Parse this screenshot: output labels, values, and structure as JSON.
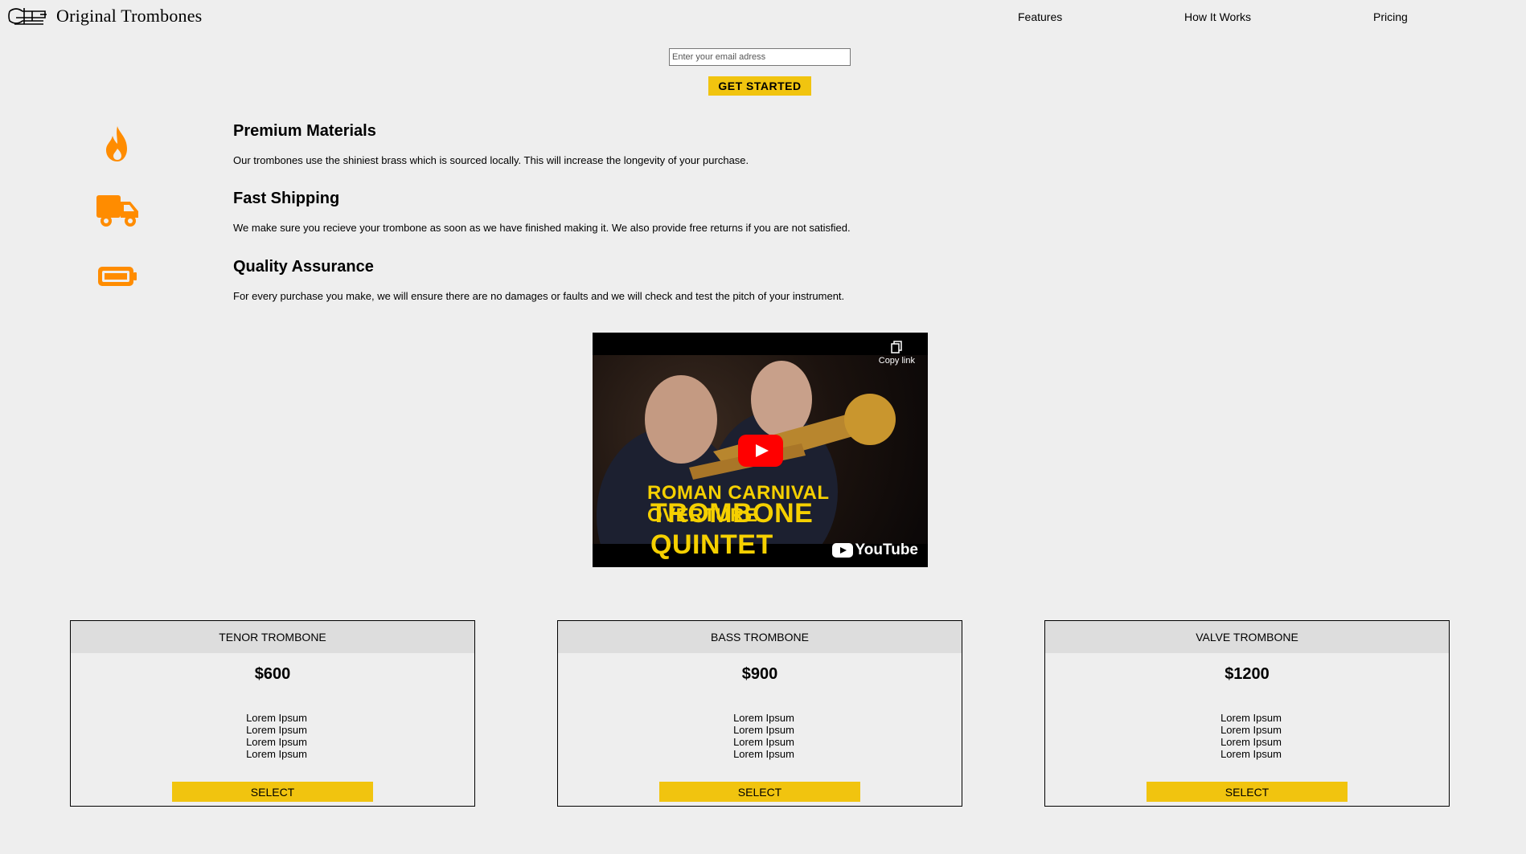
{
  "brand": {
    "name": "Original Trombones",
    "logo_icon": "trombone-icon"
  },
  "nav": {
    "items": [
      {
        "label": "Features"
      },
      {
        "label": "How It Works"
      },
      {
        "label": "Pricing"
      }
    ]
  },
  "signup": {
    "email_placeholder": "Enter your email adress",
    "button_label": "GET STARTED"
  },
  "features": [
    {
      "icon": "fire-icon",
      "title": "Premium Materials",
      "text": "Our trombones use the shiniest brass which is sourced locally. This will increase the longevity of your purchase."
    },
    {
      "icon": "truck-icon",
      "title": "Fast Shipping",
      "text": "We make sure you recieve your trombone as soon as we have finished making it. We also provide free returns if you are not satisfied."
    },
    {
      "icon": "battery-icon",
      "title": "Quality Assurance",
      "text": "For every purchase you make, we will ensure there are no damages or faults and we will check and test the pitch of your instrument."
    }
  ],
  "video": {
    "title_line1": "ROMAN CARNIVAL OVERTURE",
    "title_line2": "TROMBONE QUINTET",
    "copy_label": "Copy link",
    "platform": "YouTube"
  },
  "accent_color": "#f1c40f",
  "icon_color": "#ff8c00",
  "pricing": [
    {
      "name": "TENOR TROMBONE",
      "price": "$600",
      "features": [
        "Lorem Ipsum",
        "Lorem Ipsum",
        "Lorem Ipsum",
        "Lorem Ipsum"
      ],
      "button": "SELECT"
    },
    {
      "name": "BASS TROMBONE",
      "price": "$900",
      "features": [
        "Lorem Ipsum",
        "Lorem Ipsum",
        "Lorem Ipsum",
        "Lorem Ipsum"
      ],
      "button": "SELECT"
    },
    {
      "name": "VALVE TROMBONE",
      "price": "$1200",
      "features": [
        "Lorem Ipsum",
        "Lorem Ipsum",
        "Lorem Ipsum",
        "Lorem Ipsum"
      ],
      "button": "SELECT"
    }
  ]
}
